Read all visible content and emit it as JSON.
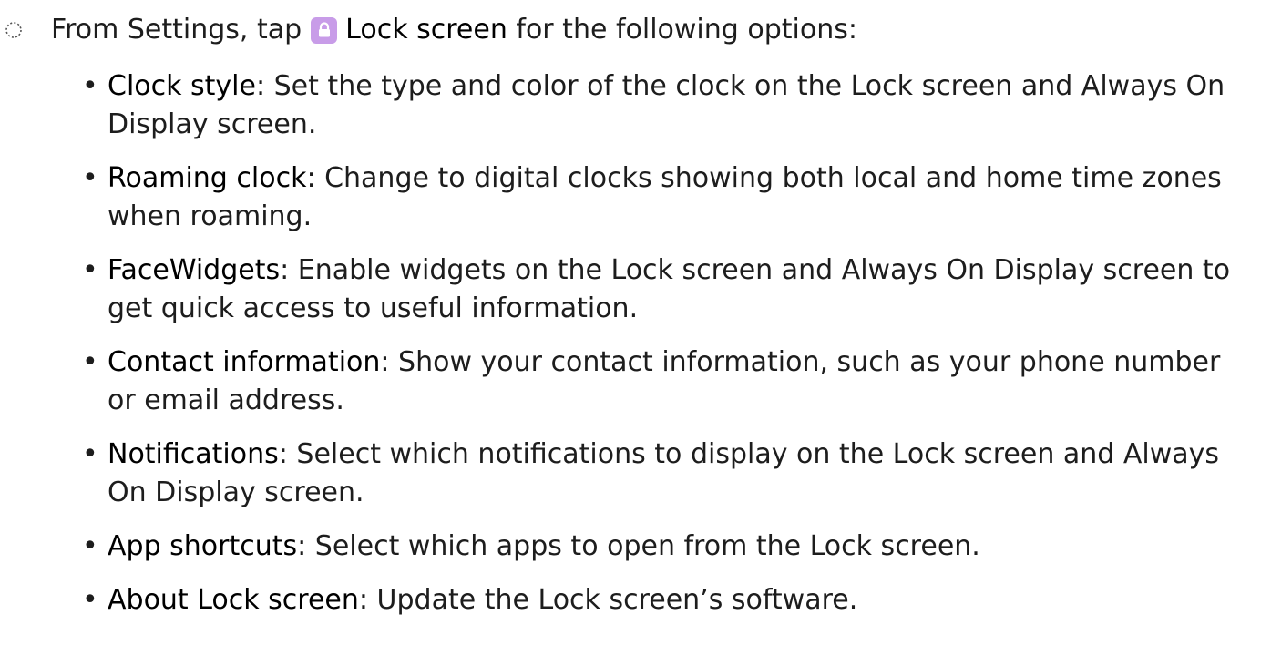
{
  "colors": {
    "text": "#1d1d1d",
    "lock_icon_bg": "#c89ce8",
    "lock_icon_fg": "#ffffff"
  },
  "intro": {
    "step_icon": "dotted-circle-icon",
    "prefix": "From Settings, tap",
    "settings_icon": "lock-icon",
    "target": "Lock screen",
    "suffix": "for the following options:"
  },
  "options": [
    {
      "term": "Clock style",
      "sep": ":",
      "text": " Set the type and color of the clock on the Lock screen and Always On Display screen."
    },
    {
      "term": "Roaming clock",
      "sep": ":",
      "text": " Change to digital clocks showing both local and home time zones when roaming."
    },
    {
      "term": "FaceWidgets",
      "sep": ":",
      "text": " Enable widgets on the Lock screen and Always On Display screen to get quick access to useful information."
    },
    {
      "term": "Contact information",
      "sep": ":",
      "text": " Show your contact information, such as your phone number or email address."
    },
    {
      "term": "Notifications",
      "sep": ":",
      "text": " Select which notifications to display on the Lock screen and Always On Display screen."
    },
    {
      "term": "App shortcuts",
      "sep": ":",
      "text": " Select which apps to open from the Lock screen."
    },
    {
      "term": "About Lock screen",
      "sep": ":",
      "text": " Update the Lock screen’s software."
    }
  ]
}
